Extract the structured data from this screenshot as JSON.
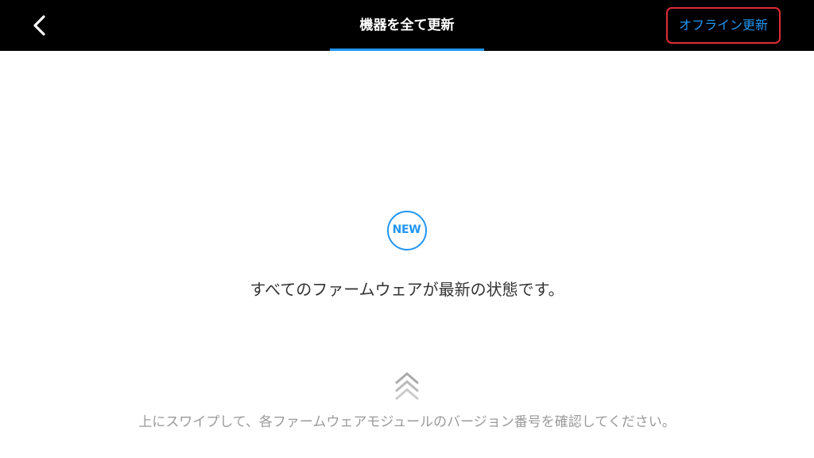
{
  "header": {
    "back_icon": "chevron-left-icon",
    "title": "機器を全て更新",
    "offline_update_label": "オフライン更新",
    "accent_color": "#2196f3",
    "highlight_color": "#e02b37"
  },
  "main": {
    "badge_label": "NEW",
    "status_message": "すべてのファームウェアが最新の状態です。",
    "swipe_icon": "double-chevron-up-icon",
    "swipe_hint": "上にスワイプして、各ファームウェアモジュールのバージョン番号を確認してください。"
  }
}
